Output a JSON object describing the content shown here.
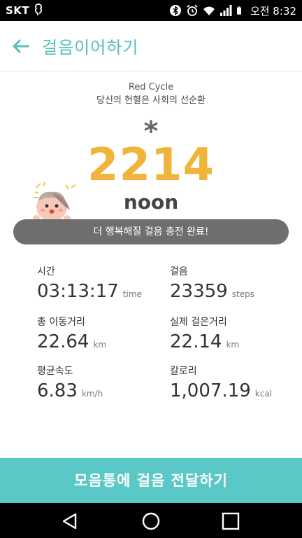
{
  "status_bar": {
    "carrier": "SKT",
    "time": "오전 8:32",
    "icons": [
      "notification-icon",
      "bluetooth-icon",
      "alarm-icon",
      "wifi-icon",
      "signal-icon",
      "battery-icon"
    ]
  },
  "header": {
    "back_icon": "arrow-left-icon",
    "title": "걸음이어하기"
  },
  "campaign": {
    "name": "Red Cycle",
    "slogan": "당신의 헌혈은 사회의 선순환"
  },
  "summary": {
    "symbol": "*",
    "value": "2214",
    "unit": "noon"
  },
  "message": "더 행복해질 걸음 충전 완료!",
  "stats": {
    "time": {
      "label": "시간",
      "value": "03:13:17",
      "unit": "time"
    },
    "steps": {
      "label": "걸음",
      "value": "23359",
      "unit": "steps"
    },
    "total_distance": {
      "label": "총 이동거리",
      "value": "22.64",
      "unit": "km"
    },
    "walked_distance": {
      "label": "실제 걸은거리",
      "value": "22.14",
      "unit": "km"
    },
    "avg_speed": {
      "label": "평균속도",
      "value": "6.83",
      "unit": "km/h"
    },
    "calories": {
      "label": "칼로리",
      "value": "1,007.19",
      "unit": "kcal"
    }
  },
  "cta": {
    "label": "모음통에 걸음 전달하기"
  },
  "nav": {
    "icons": [
      "back-triangle-icon",
      "home-circle-icon",
      "recents-square-icon"
    ]
  },
  "colors": {
    "accent": "#54bfbd",
    "cta_background": "#5ac8c6",
    "highlight_number": "#f0b43a",
    "banner": "#6e6e6e"
  }
}
